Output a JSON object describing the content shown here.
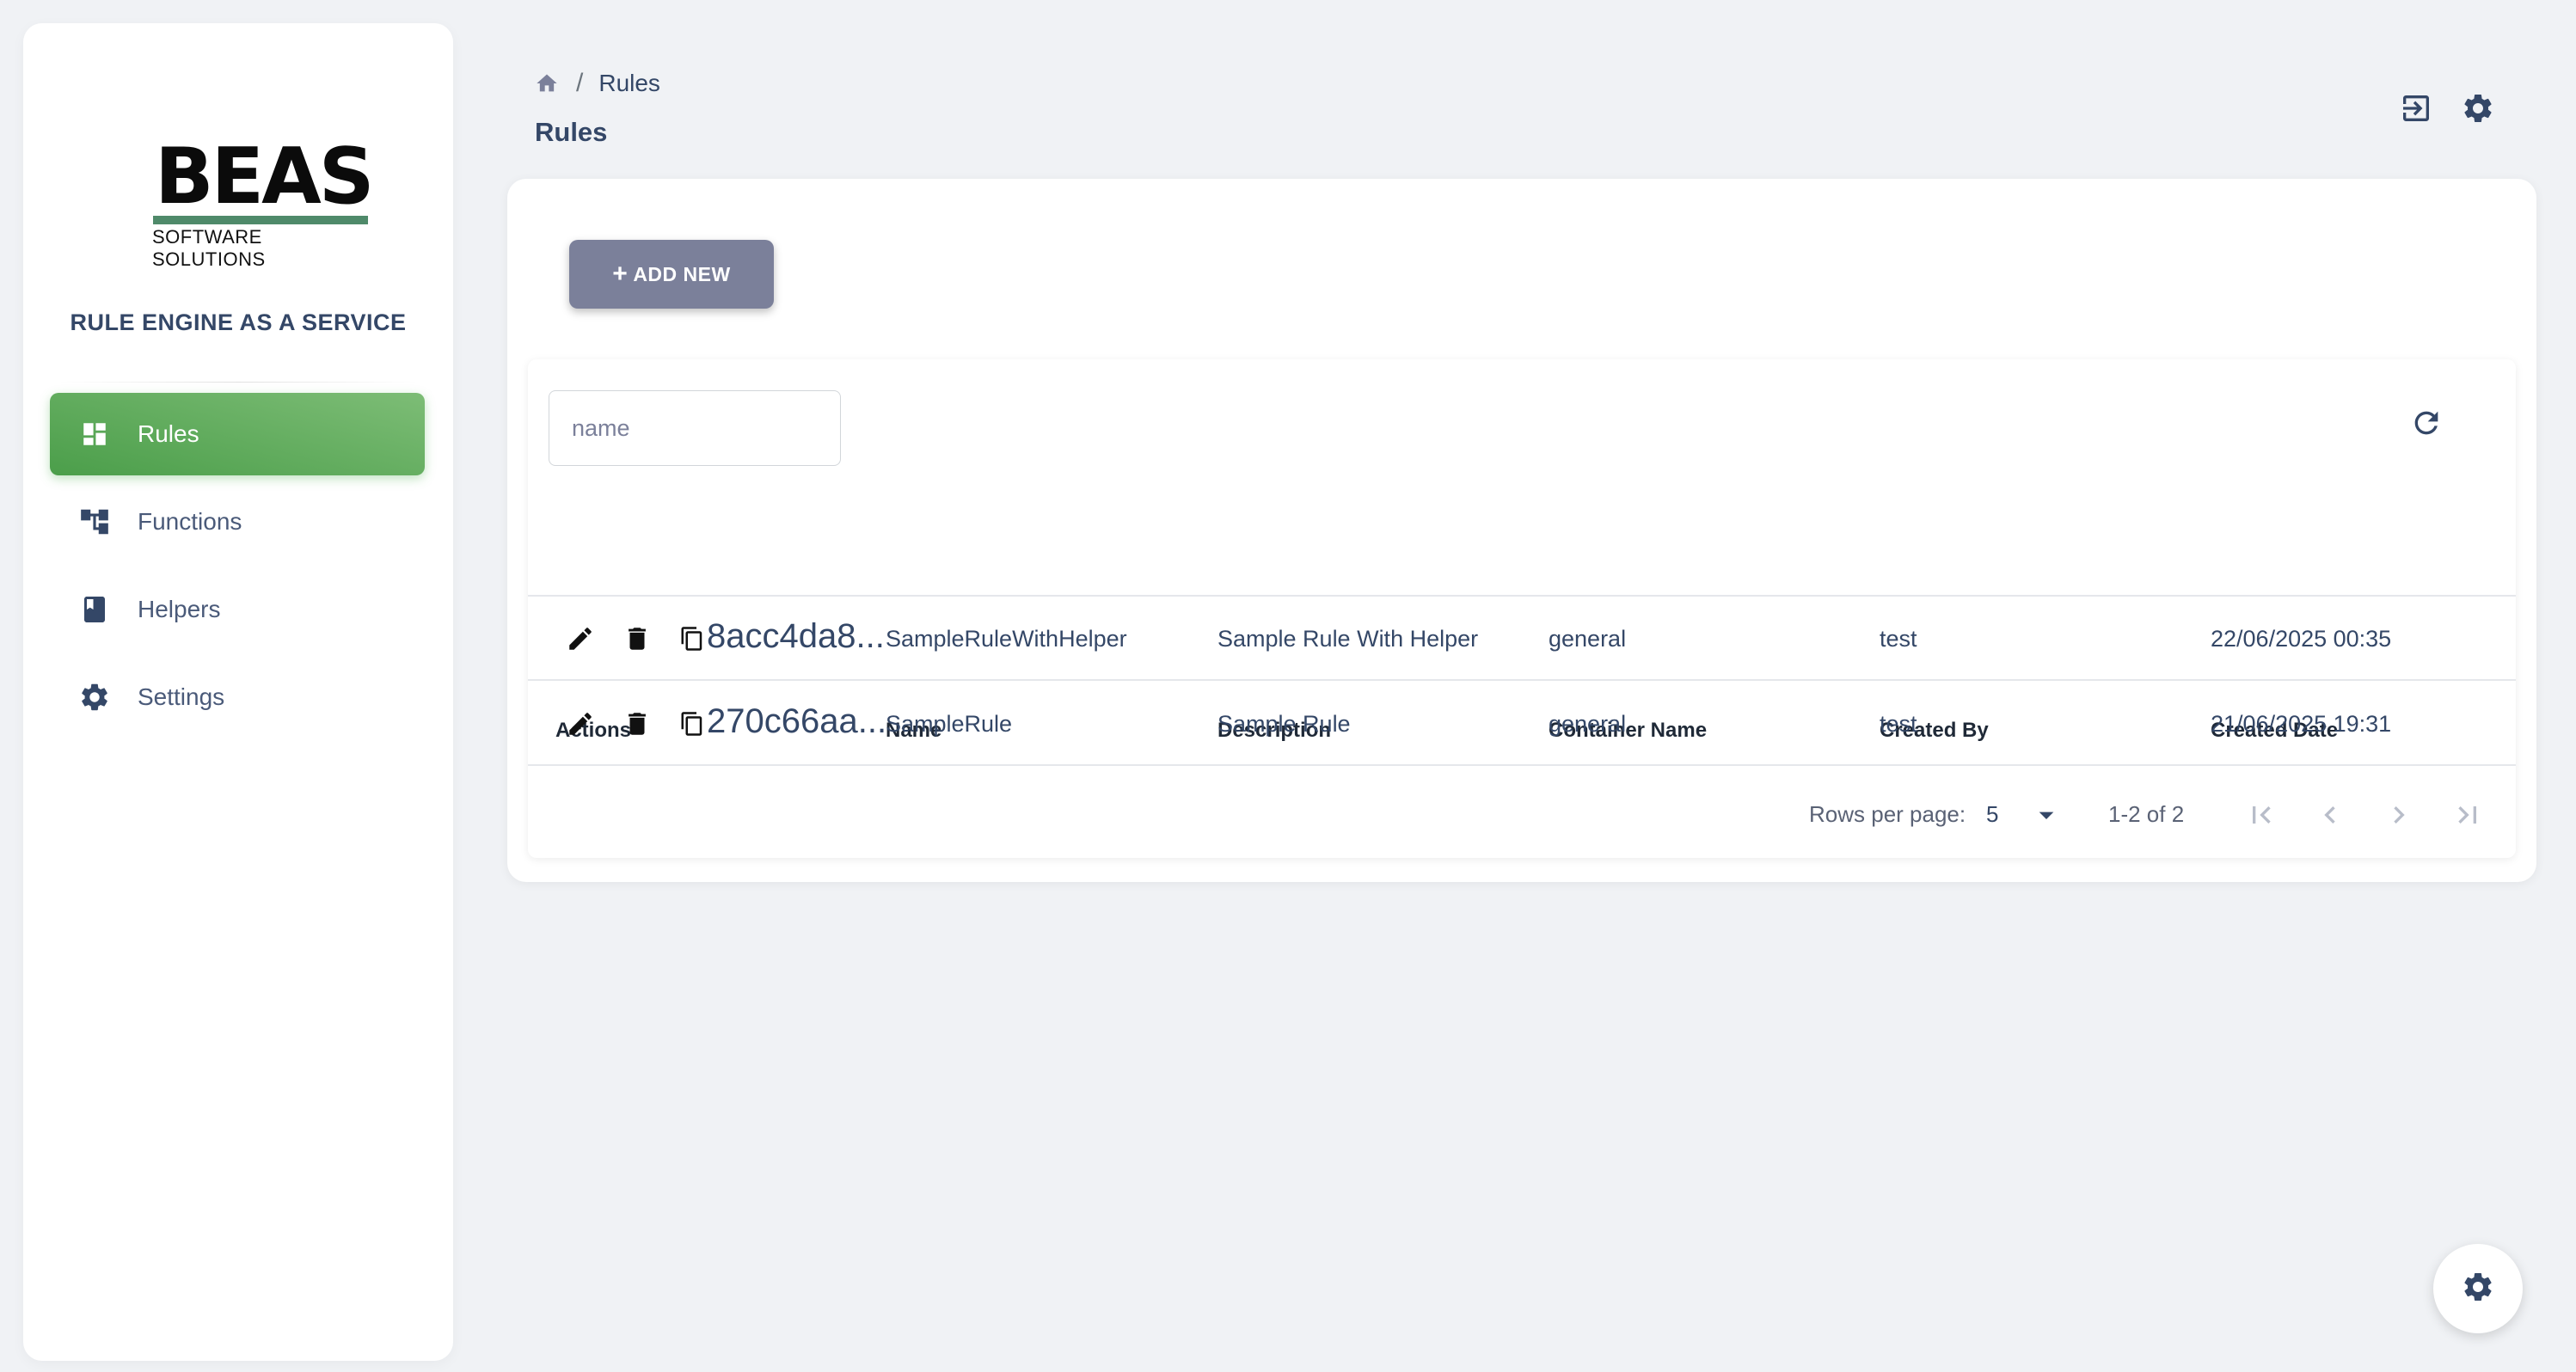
{
  "brand": {
    "logo_text": "BEAS",
    "logo_subtitle": "SOFTWARE SOLUTIONS",
    "app_title": "RULE ENGINE AS A SERVICE"
  },
  "sidebar": {
    "items": [
      {
        "label": "Rules",
        "icon": "dashboard-icon",
        "active": true
      },
      {
        "label": "Functions",
        "icon": "functions-icon",
        "active": false
      },
      {
        "label": "Helpers",
        "icon": "book-icon",
        "active": false
      },
      {
        "label": "Settings",
        "icon": "gear-icon",
        "active": false
      }
    ]
  },
  "header": {
    "breadcrumb_sep": "/",
    "breadcrumb_current": "Rules",
    "title": "Rules",
    "icons": [
      "logout-icon",
      "gear-icon"
    ]
  },
  "toolbar": {
    "add_label": "ADD NEW",
    "add_icon": "plus"
  },
  "search": {
    "placeholder": "name",
    "value": ""
  },
  "table": {
    "columns": [
      "Actions",
      "Name",
      "Description",
      "Container Name",
      "Created By",
      "Created Date"
    ],
    "rows": [
      {
        "id": "8acc4da8...",
        "name": "SampleRuleWithHelper",
        "description": "Sample Rule With Helper",
        "container": "general",
        "created_by": "test",
        "created_date": "22/06/2025 00:35"
      },
      {
        "id": "270c66aa...",
        "name": "SampleRule",
        "description": "Sample Rule",
        "container": "general",
        "created_by": "test",
        "created_date": "21/06/2025 19:31"
      }
    ]
  },
  "pagination": {
    "rows_per_page_label": "Rows per page:",
    "rows_per_page": "5",
    "range": "1-2 of 2"
  },
  "colors": {
    "active_nav": "#4b9e4a",
    "button": "#7b809a",
    "text": "#344767",
    "background": "#f0f2f5"
  }
}
